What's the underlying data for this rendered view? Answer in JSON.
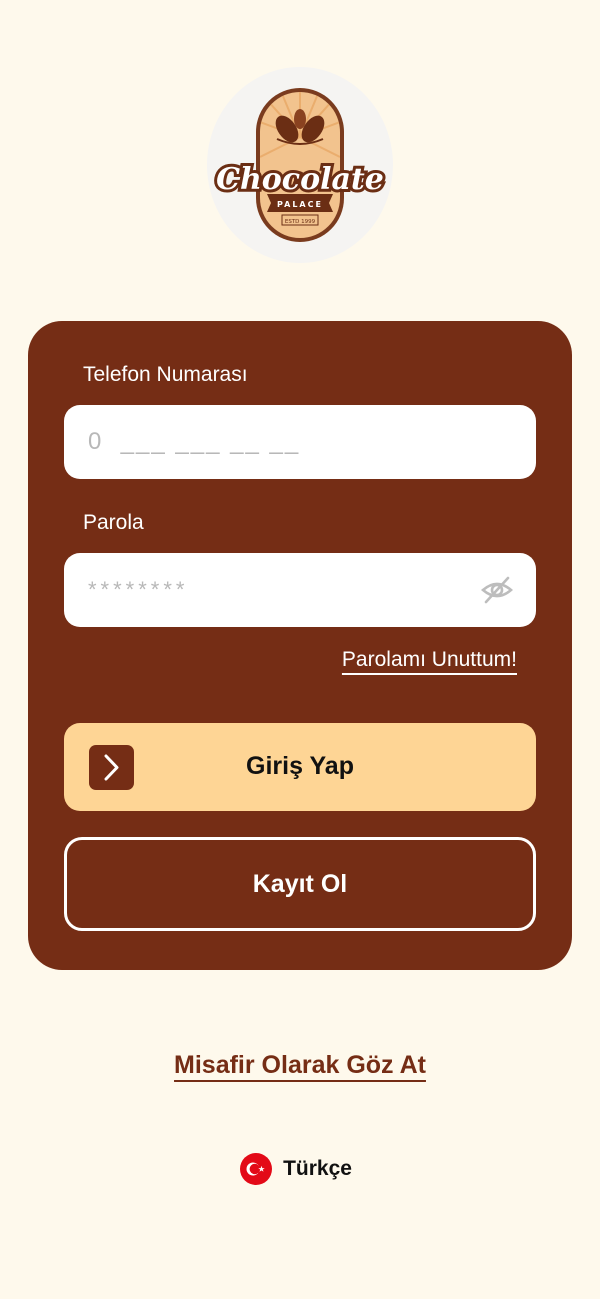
{
  "brand": {
    "logo_text_main": "Chocolate",
    "logo_text_sub": "PALACE",
    "logo_text_estd": "ESTD 1999"
  },
  "form": {
    "phone_label": "Telefon Numarası",
    "phone_placeholder": "0  ___ ___ __ __",
    "password_label": "Parola",
    "password_placeholder": "********",
    "forgot_password": "Parolamı Unuttum!",
    "login_button": "Giriş Yap",
    "register_button": "Kayıt Ol"
  },
  "guest_link": "Misafir Olarak Göz At",
  "language": {
    "label": "Türkçe",
    "flag_icon": "turkey-flag-icon"
  },
  "colors": {
    "background": "#FEF9EC",
    "card": "#752D15",
    "login_button": "#FED595",
    "accent_text": "#752D15"
  }
}
